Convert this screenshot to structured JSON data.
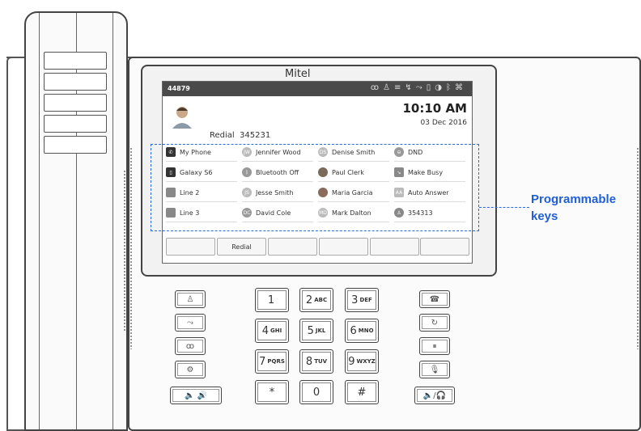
{
  "brand": "Mitel",
  "annotation": {
    "line1": "Programmable",
    "line2": "keys"
  },
  "status": {
    "extension": "44879",
    "icons": [
      "voicemail-icon",
      "contact-icon",
      "message-icon",
      "missed-call-icon",
      "call-history-icon",
      "battery-icon",
      "headset-icon",
      "bluetooth-icon",
      "network-icon"
    ]
  },
  "clock": {
    "time": "10:10 AM",
    "date": "03 Dec 2016"
  },
  "redial": {
    "label": "Redial",
    "number": "345231"
  },
  "prog_keys": [
    {
      "label": "My Phone",
      "icon": "phone-icon"
    },
    {
      "label": "Jennifer Wood",
      "icon": "contact-initials-icon",
      "initials": "JW"
    },
    {
      "label": "Denise Smith",
      "icon": "contact-initials-icon",
      "initials": "DS"
    },
    {
      "label": "DND",
      "icon": "dnd-icon"
    },
    {
      "label": "Galaxy S6",
      "icon": "mobile-icon"
    },
    {
      "label": "Bluetooth Off",
      "icon": "bluetooth-icon"
    },
    {
      "label": "Paul Clerk",
      "icon": "contact-photo-icon"
    },
    {
      "label": "Make Busy",
      "icon": "make-busy-icon"
    },
    {
      "label": "Line 2",
      "icon": "line-icon"
    },
    {
      "label": "Jesse Smith",
      "icon": "contact-initials-icon",
      "initials": "JS"
    },
    {
      "label": "Maria Garcia",
      "icon": "contact-photo-icon"
    },
    {
      "label": "Auto Answer",
      "icon": "auto-answer-icon"
    },
    {
      "label": "Line 3",
      "icon": "line-icon"
    },
    {
      "label": "David Cole",
      "icon": "contact-initials-icon",
      "initials": "DC"
    },
    {
      "label": "Mark Dalton",
      "icon": "contact-initials-icon",
      "initials": "MD"
    },
    {
      "label": "354313",
      "icon": "speed-dial-icon"
    }
  ],
  "softkeys": [
    "",
    "Redial",
    "",
    "",
    "",
    ""
  ],
  "dialpad": [
    {
      "digit": "1",
      "letters": ""
    },
    {
      "digit": "2",
      "letters": "ABC"
    },
    {
      "digit": "3",
      "letters": "DEF"
    },
    {
      "digit": "4",
      "letters": "GHI"
    },
    {
      "digit": "5",
      "letters": "JKL"
    },
    {
      "digit": "6",
      "letters": "MNO"
    },
    {
      "digit": "7",
      "letters": "PQRS"
    },
    {
      "digit": "8",
      "letters": "TUV"
    },
    {
      "digit": "9",
      "letters": "WXYZ"
    },
    {
      "digit": "*",
      "letters": ""
    },
    {
      "digit": "0",
      "letters": ""
    },
    {
      "digit": "#",
      "letters": ""
    }
  ],
  "left_keys": [
    {
      "icon": "directory-icon",
      "glyph": "♙"
    },
    {
      "icon": "call-history-icon",
      "glyph": "⤳"
    },
    {
      "icon": "voicemail-icon",
      "glyph": "ꝏ"
    },
    {
      "icon": "settings-icon",
      "glyph": "⚙"
    },
    {
      "icon": "volume-icon",
      "glyph": "🔈 🔊"
    }
  ],
  "right_keys": [
    {
      "icon": "hang-up-icon",
      "glyph": "☎"
    },
    {
      "icon": "redial-icon",
      "glyph": "↻"
    },
    {
      "icon": "hold-icon",
      "glyph": "⏸"
    },
    {
      "icon": "mute-icon",
      "glyph": "🎙"
    },
    {
      "icon": "speaker-headset-icon",
      "glyph": "🔈/🎧"
    }
  ]
}
